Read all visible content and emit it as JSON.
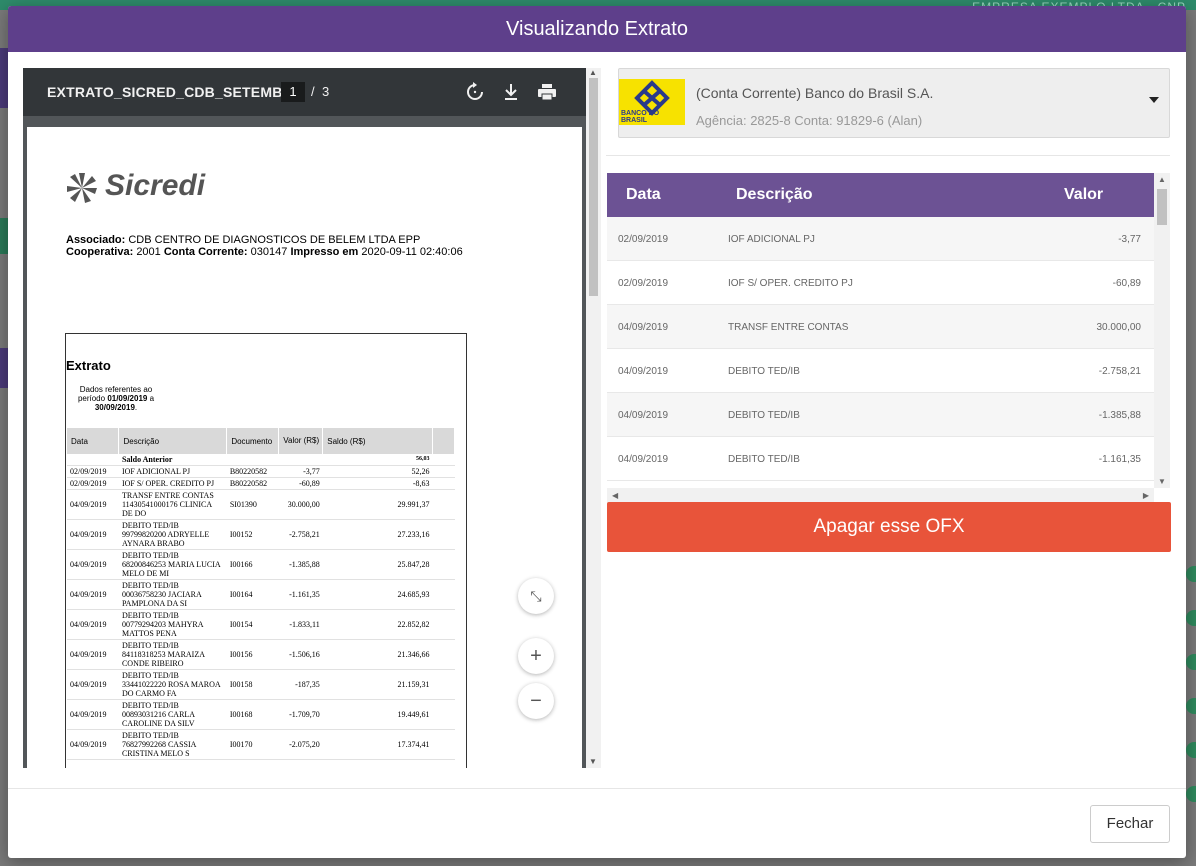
{
  "background": {
    "top_right_text": "EMPRESA EXEMPLO LTDA - CNP"
  },
  "modal": {
    "title": "Visualizando Extrato",
    "close_label": "Fechar"
  },
  "pdf": {
    "filename": "EXTRATO_SICRED_CDB_SETEMBR...",
    "page_current": "1",
    "page_separator": "/",
    "page_total": "3",
    "logo_text": "Sicredi",
    "associado_label": "Associado:",
    "associado_value": "CDB CENTRO DE DIAGNOSTICOS DE BELEM LTDA EPP",
    "cooperativa_label": "Cooperativa:",
    "cooperativa_value": "2001",
    "conta_label": "Conta Corrente:",
    "conta_value": "030147",
    "impresso_label": "Impresso em",
    "impresso_value": "2020-09-11 02:40:06",
    "extrato_title": "Extrato",
    "period_intro": "Dados referentes ao período",
    "period_start": "01/09/2019",
    "period_a": "a",
    "period_end": "30/09/2019",
    "columns": [
      "Data",
      "Descrição",
      "Documento",
      "Valor (R$)",
      "Saldo (R$)"
    ],
    "saldo_anterior_label": "Saldo Anterior",
    "saldo_anterior_value": "56,03",
    "rows": [
      [
        "02/09/2019",
        "IOF ADICIONAL PJ",
        "B80220582",
        "-3,77",
        "52,26"
      ],
      [
        "02/09/2019",
        "IOF S/ OPER. CREDITO PJ",
        "B80220582",
        "-60,89",
        "-8,63"
      ],
      [
        "04/09/2019",
        "TRANSF ENTRE CONTAS 11430541000176 CLINICA DE DO",
        "SI01390",
        "30.000,00",
        "29.991,37"
      ],
      [
        "04/09/2019",
        "DEBITO TED/IB 99799820200 ADRYELLE AYNARA BRABO",
        "I00152",
        "-2.758,21",
        "27.233,16"
      ],
      [
        "04/09/2019",
        "DEBITO TED/IB 68200846253 MARIA LUCIA MELO DE MI",
        "I00166",
        "-1.385,88",
        "25.847,28"
      ],
      [
        "04/09/2019",
        "DEBITO TED/IB 00036758230 JACIARA PAMPLONA DA SI",
        "I00164",
        "-1.161,35",
        "24.685,93"
      ],
      [
        "04/09/2019",
        "DEBITO TED/IB 00779294203 MAHYRA MATTOS PENA",
        "I00154",
        "-1.833,11",
        "22.852,82"
      ],
      [
        "04/09/2019",
        "DEBITO TED/IB 84118318253 MARAIZA CONDE RIBEIRO",
        "I00156",
        "-1.506,16",
        "21.346,66"
      ],
      [
        "04/09/2019",
        "DEBITO TED/IB 33441022220 ROSA MAROA DO CARMO FA",
        "I00158",
        "-187,35",
        "21.159,31"
      ],
      [
        "04/09/2019",
        "DEBITO TED/IB 00893031216 CARLA CAROLINE DA SILV",
        "I00168",
        "-1.709,70",
        "19.449,61"
      ],
      [
        "04/09/2019",
        "DEBITO TED/IB 76827992268 CASSIA CRISTINA MELO S",
        "I00170",
        "-2.075,20",
        "17.374,41"
      ]
    ],
    "zoom_fit_icon": "⤡",
    "zoom_in_label": "+",
    "zoom_out_label": "−"
  },
  "bank": {
    "name": "(Conta Corrente) Banco do Brasil S.A.",
    "details": "Agência: 2825-8 Conta: 91829-6 (Alan)",
    "logo_text": "BANCO DO BRASIL"
  },
  "transactions": {
    "columns": {
      "date": "Data",
      "description": "Descrição",
      "value": "Valor"
    },
    "rows": [
      {
        "date": "02/09/2019",
        "description": "IOF ADICIONAL PJ",
        "value": "-3,77"
      },
      {
        "date": "02/09/2019",
        "description": "IOF S/ OPER. CREDITO PJ",
        "value": "-60,89"
      },
      {
        "date": "04/09/2019",
        "description": "TRANSF ENTRE CONTAS",
        "value": "30.000,00"
      },
      {
        "date": "04/09/2019",
        "description": "DEBITO TED/IB",
        "value": "-2.758,21"
      },
      {
        "date": "04/09/2019",
        "description": "DEBITO TED/IB",
        "value": "-1.385,88"
      },
      {
        "date": "04/09/2019",
        "description": "DEBITO TED/IB",
        "value": "-1.161,35"
      }
    ]
  },
  "actions": {
    "delete_label": "Apagar esse OFX"
  },
  "colors": {
    "header_purple": "#5e3f8b",
    "table_header": "#6c5294",
    "delete_red": "#e8543a",
    "bb_yellow": "#f7e200"
  }
}
